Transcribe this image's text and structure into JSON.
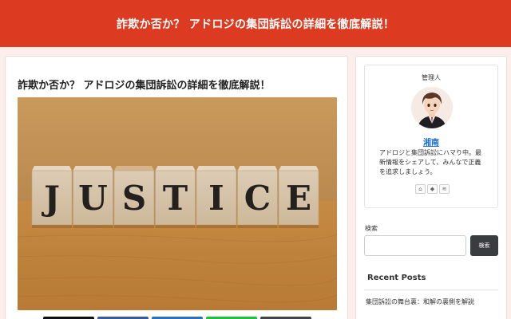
{
  "header": {
    "site_title": "詐欺か否か？ アドロジの集団訴訟の詳細を徹底解説！"
  },
  "article": {
    "title": "詐欺か否か？ アドロジの集団訴訟の詳細を徹底解説！",
    "image_letters": [
      "J",
      "U",
      "S",
      "T",
      "I",
      "C",
      "E"
    ],
    "share_buttons": [
      "x-share",
      "facebook-share",
      "hatena-share",
      "line-share",
      "copy-share"
    ]
  },
  "sidebar": {
    "profile": {
      "heading": "管理人",
      "name": "湘南",
      "description": "アドロジと集団訴訟にハマり中。最新情報をシェアして、みんなで正義を追求しましょう。",
      "follow_icons": [
        {
          "icon": "home-icon",
          "glyph": "⌂"
        },
        {
          "icon": "feedly-icon",
          "glyph": "◆"
        },
        {
          "icon": "rss-icon",
          "glyph": "≋"
        }
      ]
    },
    "search": {
      "label": "検索",
      "placeholder": "",
      "value": "",
      "button_label": "検索"
    },
    "recent_posts": {
      "heading": "Recent Posts",
      "items": [
        "集団訴訟の舞台裏：和解の裏側を解説"
      ]
    }
  },
  "colors": {
    "header_bg": "#dc3b22",
    "page_bg": "#fbeeec",
    "link": "#1a6fd0",
    "button_dark": "#3a3d40"
  }
}
